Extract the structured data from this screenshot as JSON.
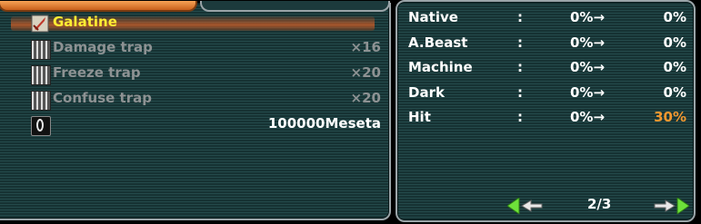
{
  "inventory": {
    "items": [
      {
        "label": "Galatine",
        "qty": "",
        "icon": "sword-icon",
        "selected": true
      },
      {
        "label": "Damage trap",
        "qty": "×16",
        "icon": "trap-icon"
      },
      {
        "label": "Freeze trap",
        "qty": "×20",
        "icon": "trap-icon"
      },
      {
        "label": "Confuse trap",
        "qty": "×20",
        "icon": "trap-icon"
      },
      {
        "label": "100000Meseta",
        "qty": "",
        "icon": "meseta-ring-icon"
      }
    ]
  },
  "stats": {
    "rows": [
      {
        "name": "Native",
        "colon": ":",
        "from": "0%→",
        "to": "0%"
      },
      {
        "name": "A.Beast",
        "colon": ":",
        "from": "0%→",
        "to": "0%"
      },
      {
        "name": "Machine",
        "colon": ":",
        "from": "0%→",
        "to": "0%"
      },
      {
        "name": "Dark",
        "colon": ":",
        "from": "0%→",
        "to": "0%"
      },
      {
        "name": "Hit",
        "colon": ":",
        "from": "0%→",
        "to": "30%"
      }
    ],
    "highlight_color": "#f1972f"
  },
  "pager": {
    "text": "2/3",
    "prev_icon": "arrow-left-icon",
    "next_icon": "arrow-right-icon"
  },
  "colors": {
    "selected_text": "#ffee33",
    "dim_text": "#8d9293",
    "accent_tab": "#f7a356"
  }
}
